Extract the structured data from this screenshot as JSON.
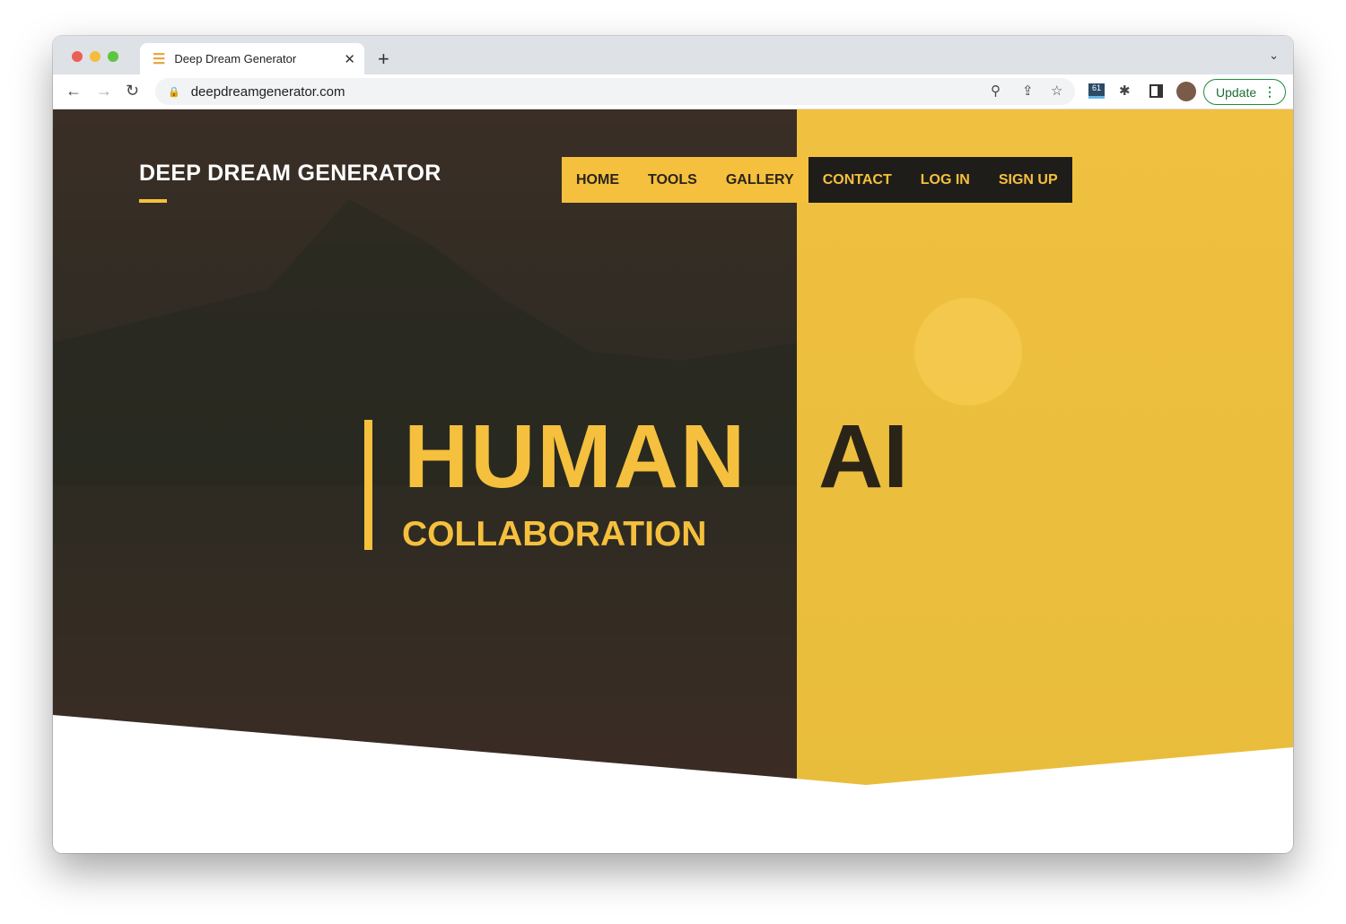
{
  "browser": {
    "tab_title": "Deep Dream Generator",
    "url": "deepdreamgenerator.com",
    "update_label": "Update",
    "extension_badge": "61"
  },
  "site": {
    "brand": "DEEP DREAM GENERATOR",
    "nav": [
      {
        "label": "HOME"
      },
      {
        "label": "TOOLS"
      },
      {
        "label": "GALLERY"
      },
      {
        "label": "CONTACT"
      },
      {
        "label": "LOG IN"
      },
      {
        "label": "SIGN UP"
      }
    ],
    "hero": {
      "word1": "HUMAN",
      "word2": "AI",
      "subtitle": "COLLABORATION"
    }
  },
  "colors": {
    "accent": "#f5c03d",
    "dark": "#1f1d1a"
  }
}
